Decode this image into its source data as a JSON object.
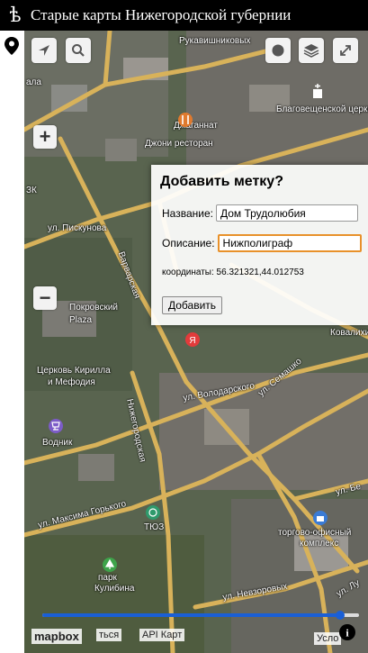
{
  "header": {
    "logo": "ѣ",
    "title": "Старые карты Нижегородской губернии"
  },
  "map": {
    "labels": {
      "label_1": "Рукавишниковых",
      "label_2": "Благовещенской церкви",
      "label_3": "Джаганнат",
      "label_4": "Джони ресторан",
      "label_5": "ул. Пискунова",
      "label_6": "Варварская",
      "label_7": "Покровский",
      "label_8": "Plaza",
      "label_9": "Церковь Кирилла",
      "label_10": "и Мефодия",
      "label_11": "ул. Володарского",
      "label_12": "ул. Семашко",
      "label_13": "Водник",
      "label_14": "Нижегородская",
      "label_15": "ул. Максима Горького",
      "label_16": "ТЮЗ",
      "label_17": "парк",
      "label_18": "Кулибина",
      "label_19": "торгово-офисный",
      "label_20": "комплекс",
      "label_21": "ул. Бе",
      "label_22": "Ковалихинск",
      "label_23": "ул. Невзоровых",
      "label_24": "ул. Лу",
      "label_25": "ала",
      "label_26": "ЗК"
    },
    "colors": {
      "road": "#d8b25a",
      "popup_focus": "#e8912a",
      "slider": "#1a5fd6"
    }
  },
  "controls": {
    "zoom_in": "+",
    "zoom_out": "−",
    "icons": [
      "locate-icon",
      "search-icon",
      "circle-icon",
      "layers-icon",
      "fullscreen-icon",
      "info-icon",
      "pin-icon"
    ]
  },
  "popup": {
    "title": "Добавить метку?",
    "name_label": "Название:",
    "name_value": "Дом Трудолюбия",
    "desc_label": "Описание:",
    "desc_value": "Нижполиграф",
    "coords_text": "координаты: 56.321321,44.012753",
    "add_button": "Добавить"
  },
  "footer": {
    "mapbox": "mapbox",
    "link_1": "ться",
    "link_2": "API Карт",
    "link_3": "Усло",
    "opacity_value": 0.94
  }
}
